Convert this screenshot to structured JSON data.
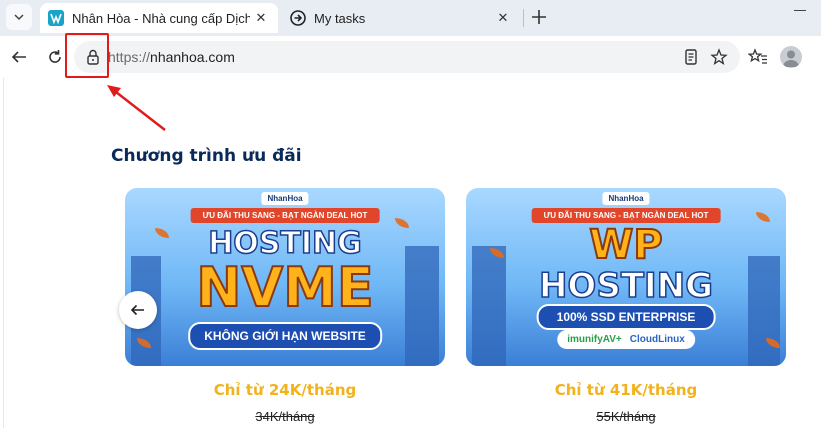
{
  "browser": {
    "tabs": [
      {
        "title": "Nhân Hòa - Nhà cung cấp Dịch vụ",
        "active": true,
        "favicon": "nhanhoa-logo-icon"
      },
      {
        "title": "My tasks",
        "active": false,
        "favicon": "arrow-circle-icon"
      }
    ],
    "address": {
      "scheme": "https://",
      "host": "nhanhoa.com"
    },
    "accent_color": "#e01b1b"
  },
  "page": {
    "section_title": "Chương trình ưu đãi",
    "cards": [
      {
        "logo": "NhanHoa",
        "ribbon": "ƯU ĐÃI THU SANG - BẠT NGÀN DEAL HOT",
        "line1": "HOSTING",
        "line2": "NVME",
        "pill": "KHÔNG GIỚI HẠN WEBSITE",
        "price": "Chỉ từ 24K/tháng",
        "old_price": "34K/tháng"
      },
      {
        "logo": "NhanHoa",
        "ribbon": "ƯU ĐÃI THU SANG - BẠT NGÀN DEAL HOT",
        "line1": "WP",
        "line2": "HOSTING",
        "pill": "100% SSD ENTERPRISE",
        "badge1": "imunifyAV+",
        "badge2": "CloudLinux",
        "price": "Chỉ từ 41K/tháng",
        "old_price": "55K/tháng"
      }
    ]
  }
}
